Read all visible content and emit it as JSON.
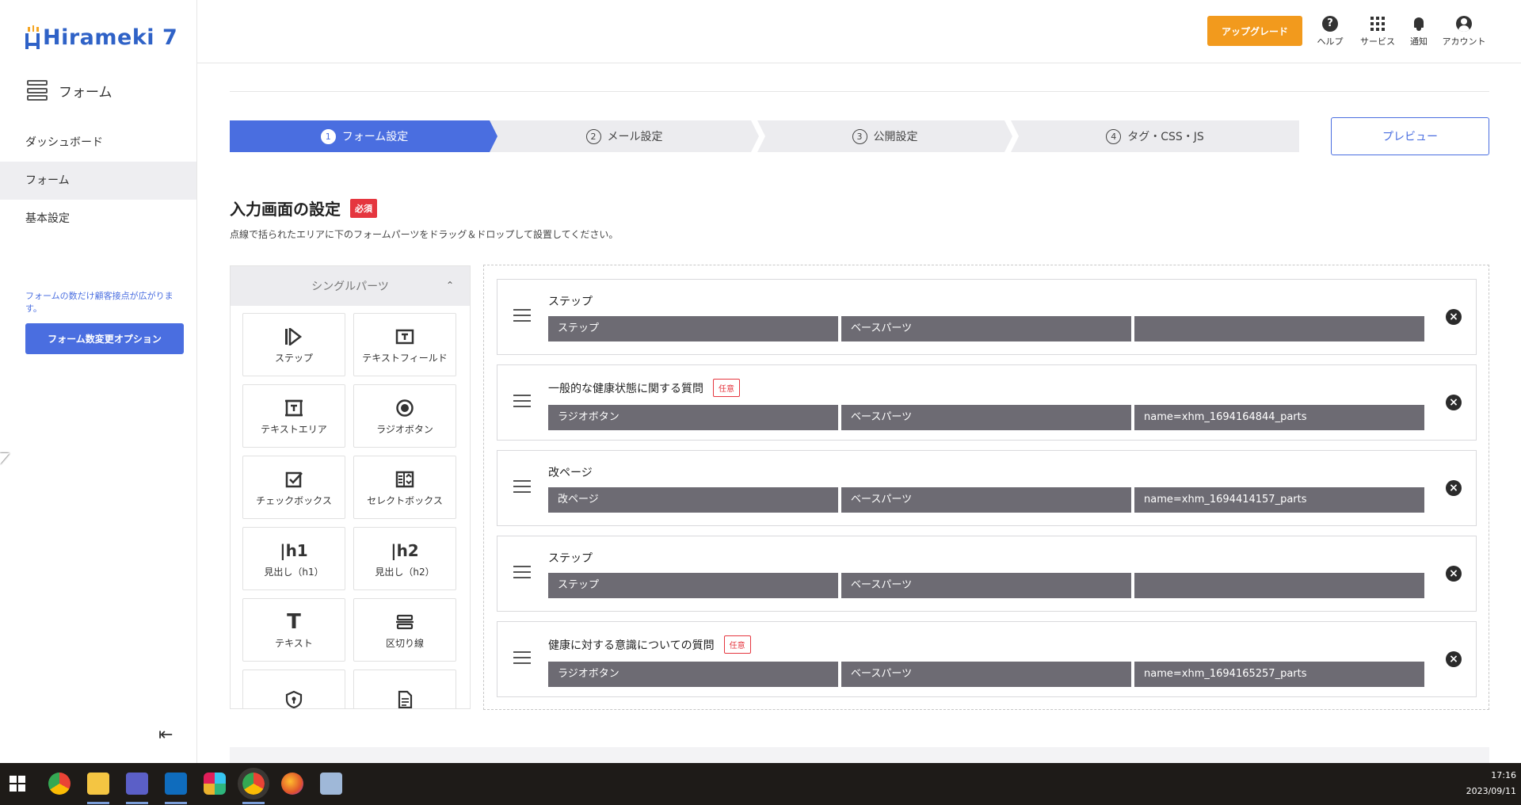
{
  "app": {
    "logo_text": "Hirameki 7"
  },
  "sidebar": {
    "section_title": "フォーム",
    "items": [
      {
        "label": "ダッシュボード"
      },
      {
        "label": "フォーム"
      },
      {
        "label": "基本設定"
      }
    ],
    "note": "フォームの数だけ顧客接点が広がります。",
    "option_button": "フォーム数変更オプション"
  },
  "header": {
    "upgrade": "アップグレード",
    "help": "ヘルプ",
    "service": "サービス",
    "notify": "通知",
    "account": "アカウント"
  },
  "steps": [
    {
      "num": "1",
      "label": "フォーム設定"
    },
    {
      "num": "2",
      "label": "メール設定"
    },
    {
      "num": "3",
      "label": "公開設定"
    },
    {
      "num": "4",
      "label": "タグ・CSS・JS"
    }
  ],
  "preview_button": "プレビュー",
  "section": {
    "title": "入力画面の設定",
    "required_badge": "必須",
    "description": "点線で括られたエリアに下のフォームパーツをドラッグ＆ドロップして設置してください。"
  },
  "palette": {
    "header": "シングルパーツ",
    "items": [
      {
        "label": "ステップ",
        "icon": "step-icon"
      },
      {
        "label": "テキストフィールド",
        "icon": "text-field-icon"
      },
      {
        "label": "テキストエリア",
        "icon": "text-area-icon"
      },
      {
        "label": "ラジオボタン",
        "icon": "radio-icon"
      },
      {
        "label": "チェックボックス",
        "icon": "checkbox-icon"
      },
      {
        "label": "セレクトボックス",
        "icon": "select-icon"
      },
      {
        "label": "見出し（h1）",
        "icon": "h1-icon"
      },
      {
        "label": "見出し（h2）",
        "icon": "h2-icon"
      },
      {
        "label": "テキスト",
        "icon": "text-icon"
      },
      {
        "label": "区切り線",
        "icon": "divider-icon"
      },
      {
        "label": "",
        "icon": "shield-icon"
      },
      {
        "label": "",
        "icon": "document-icon"
      }
    ]
  },
  "rows": [
    {
      "title": "ステップ",
      "badge": "",
      "cells": [
        "ステップ",
        "ベースパーツ",
        ""
      ]
    },
    {
      "title": "一般的な健康状態に関する質問",
      "badge": "任意",
      "cells": [
        "ラジオボタン",
        "ベースパーツ",
        "name=xhm_1694164844_parts"
      ]
    },
    {
      "title": "改ページ",
      "badge": "",
      "cells": [
        "改ページ",
        "ベースパーツ",
        "name=xhm_1694414157_parts"
      ]
    },
    {
      "title": "ステップ",
      "badge": "",
      "cells": [
        "ステップ",
        "ベースパーツ",
        ""
      ]
    },
    {
      "title": "健康に対する意識についての質問",
      "badge": "任意",
      "cells": [
        "ラジオボタン",
        "ベースパーツ",
        "name=xhm_1694165257_parts"
      ]
    }
  ],
  "taskbar": {
    "time": "17:16",
    "date": "2023/09/11",
    "apps": [
      "chrome-icon",
      "file-explorer-icon",
      "teams-icon",
      "outlook-icon",
      "slack-icon",
      "chrome-profile-icon",
      "firefox-icon",
      "notepad-icon"
    ]
  },
  "colors": {
    "primary": "#4a6ee0",
    "upgrade": "#f29a1d",
    "required": "#e5363f",
    "cell": "#6d6b73"
  }
}
